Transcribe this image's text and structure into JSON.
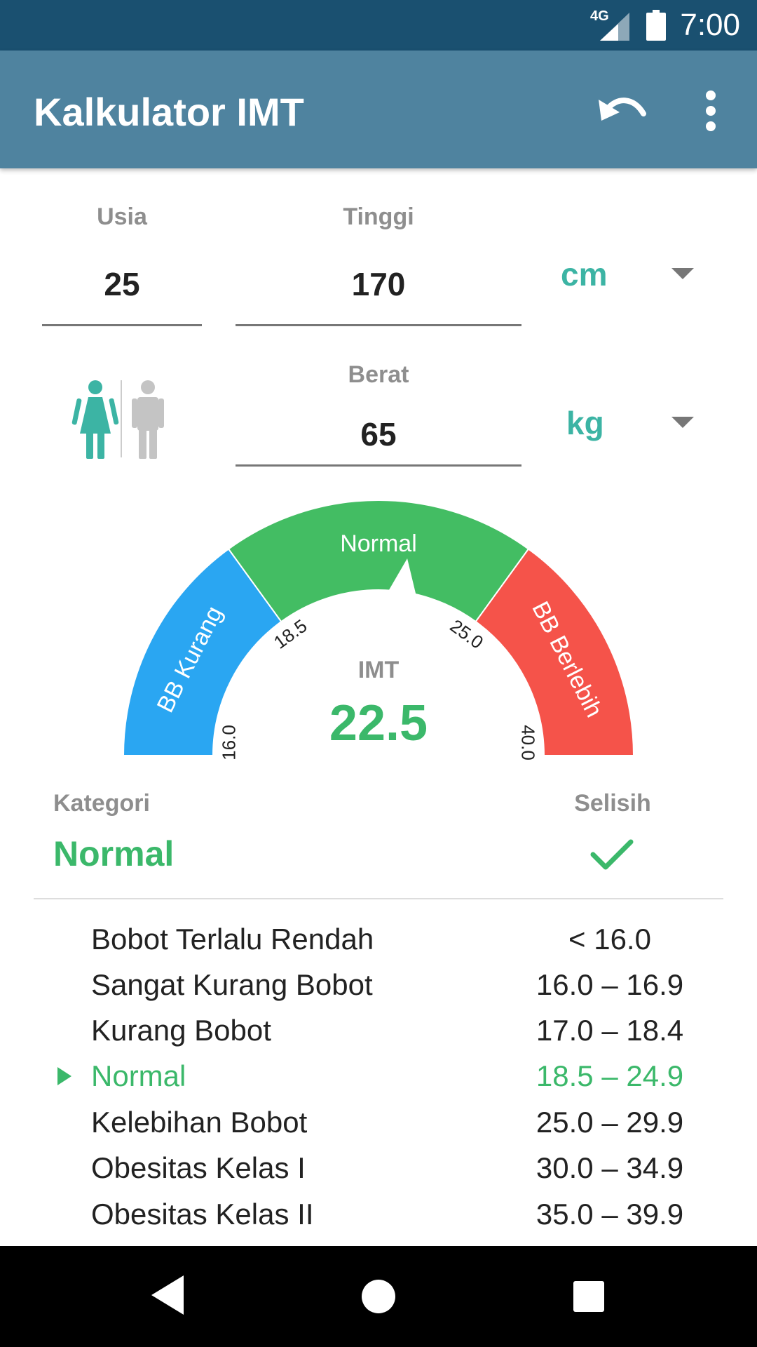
{
  "status_bar": {
    "network": "4G",
    "time": "7:00"
  },
  "toolbar": {
    "title": "Kalkulator IMT",
    "undo_icon": "undo-icon",
    "more_icon": "more-vert-icon"
  },
  "inputs": {
    "age": {
      "label": "Usia",
      "value": "25"
    },
    "height": {
      "label": "Tinggi",
      "value": "170",
      "unit": "cm"
    },
    "weight": {
      "label": "Berat",
      "value": "65",
      "unit": "kg"
    },
    "gender": {
      "selected": "female",
      "female_icon": "female-icon",
      "male_icon": "male-icon"
    }
  },
  "gauge": {
    "imt_label": "IMT",
    "imt_value": "22.5",
    "value": 22.5,
    "segments": [
      {
        "label": "BB Kurang",
        "from": 16.0,
        "to": 18.5,
        "color": "#2aa6f2"
      },
      {
        "label": "Normal",
        "from": 18.5,
        "to": 25.0,
        "color": "#43bd63"
      },
      {
        "label": "BB Berlebih",
        "from": 25.0,
        "to": 40.0,
        "color": "#f5534a"
      }
    ],
    "ticks": [
      "16.0",
      "18.5",
      "25.0",
      "40.0"
    ]
  },
  "result": {
    "category_label": "Kategori",
    "category_value": "Normal",
    "difference_label": "Selisih",
    "difference_icon": "check-icon",
    "accent_color": "#3bb86a"
  },
  "categories": [
    {
      "name": "Bobot Terlalu Rendah",
      "range": "< 16.0",
      "active": false
    },
    {
      "name": "Sangat Kurang Bobot",
      "range": "16.0 – 16.9",
      "active": false
    },
    {
      "name": "Kurang Bobot",
      "range": "17.0 – 18.4",
      "active": false
    },
    {
      "name": "Normal",
      "range": "18.5 – 24.9",
      "active": true
    },
    {
      "name": "Kelebihan Bobot",
      "range": "25.0 – 29.9",
      "active": false
    },
    {
      "name": "Obesitas Kelas I",
      "range": "30.0 – 34.9",
      "active": false
    },
    {
      "name": "Obesitas Kelas II",
      "range": "35.0 – 39.9",
      "active": false
    }
  ],
  "nav_bar": {
    "back_icon": "back-icon",
    "home_icon": "home-icon",
    "recents_icon": "recents-icon"
  }
}
